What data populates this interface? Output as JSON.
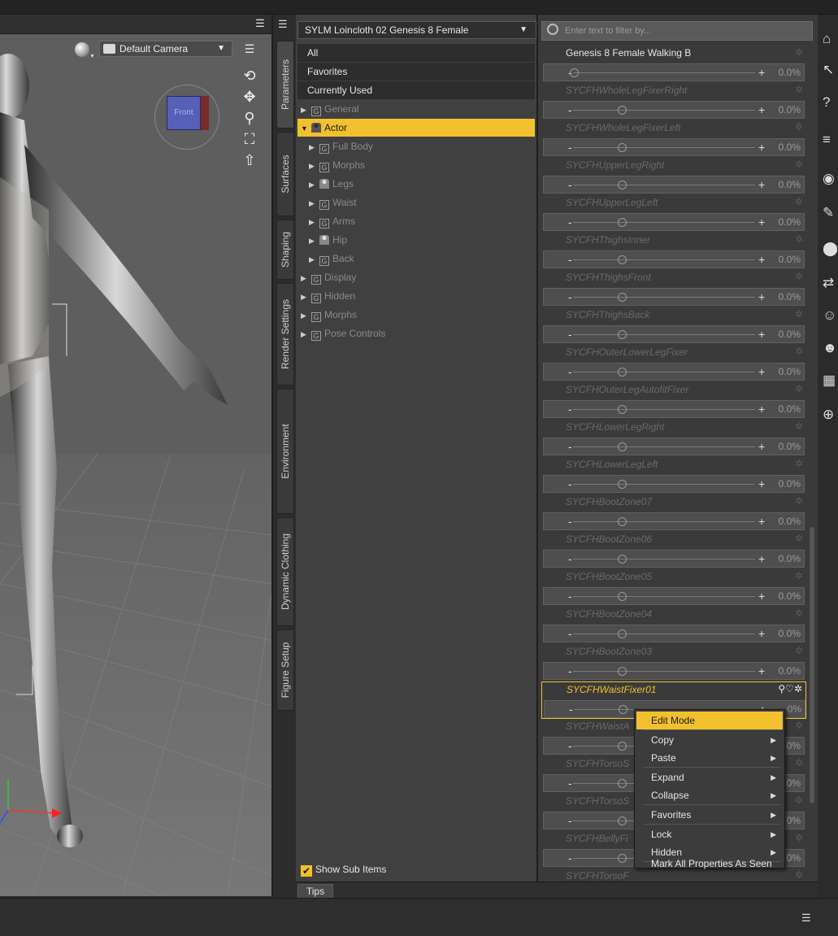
{
  "viewport": {
    "camera": "Default Camera",
    "view_cube_label": "Front"
  },
  "side_tabs": [
    "Parameters",
    "Surfaces",
    "Shaping",
    "Render Settings",
    "Environment",
    "Dynamic Clothing",
    "Figure Setup"
  ],
  "node_selector": "SYLM Loincloth 02 Genesis 8 Female",
  "categories": {
    "top": [
      "All",
      "Favorites",
      "Currently Used"
    ],
    "tree": [
      {
        "label": "General",
        "indent": 0,
        "icon": "group"
      },
      {
        "label": "Actor",
        "indent": 0,
        "icon": "figure",
        "selected": true
      },
      {
        "label": "Full Body",
        "indent": 1,
        "icon": "group"
      },
      {
        "label": "Morphs",
        "indent": 1,
        "icon": "group"
      },
      {
        "label": "Legs",
        "indent": 1,
        "icon": "figure"
      },
      {
        "label": "Waist",
        "indent": 1,
        "icon": "group"
      },
      {
        "label": "Arms",
        "indent": 1,
        "icon": "group"
      },
      {
        "label": "Hip",
        "indent": 1,
        "icon": "figure"
      },
      {
        "label": "Back",
        "indent": 1,
        "icon": "group"
      },
      {
        "label": "Display",
        "indent": 0,
        "icon": "group"
      },
      {
        "label": "Hidden",
        "indent": 0,
        "icon": "group"
      },
      {
        "label": "Morphs",
        "indent": 0,
        "icon": "group"
      },
      {
        "label": "Pose Controls",
        "indent": 0,
        "icon": "group"
      }
    ],
    "show_sub_items": "Show Sub Items"
  },
  "filter": {
    "placeholder": "Enter text to filter by..."
  },
  "properties": [
    {
      "name": "Genesis 8 Female Walking B",
      "value": "0.0%",
      "active": true,
      "knob_fraction": 0.0
    },
    {
      "name": "SYCFHWholeLegFixerRight",
      "value": "0.0%",
      "knob_fraction": 0.5
    },
    {
      "name": "SYCFHWholeLegFixerLeft",
      "value": "0.0%",
      "knob_fraction": 0.5
    },
    {
      "name": "SYCFHUpperLegRight",
      "value": "0.0%",
      "knob_fraction": 0.5
    },
    {
      "name": "SYCFHUpperLegLeft",
      "value": "0.0%",
      "knob_fraction": 0.5
    },
    {
      "name": "SYCFHThighsInner",
      "value": "0.0%",
      "knob_fraction": 0.5
    },
    {
      "name": "SYCFHThighsFront",
      "value": "0.0%",
      "knob_fraction": 0.5
    },
    {
      "name": "SYCFHThighsBack",
      "value": "0.0%",
      "knob_fraction": 0.5
    },
    {
      "name": "SYCFHOuterLowerLegFixer",
      "value": "0.0%",
      "knob_fraction": 0.5
    },
    {
      "name": "SYCFHOuterLegAutofitFixer",
      "value": "0.0%",
      "knob_fraction": 0.5
    },
    {
      "name": "SYCFHLowerLegRight",
      "value": "0.0%",
      "knob_fraction": 0.5
    },
    {
      "name": "SYCFHLowerLegLeft",
      "value": "0.0%",
      "knob_fraction": 0.5
    },
    {
      "name": "SYCFHBootZone07",
      "value": "0.0%",
      "knob_fraction": 0.5
    },
    {
      "name": "SYCFHBootZone06",
      "value": "0.0%",
      "knob_fraction": 0.5
    },
    {
      "name": "SYCFHBootZone05",
      "value": "0.0%",
      "knob_fraction": 0.5
    },
    {
      "name": "SYCFHBootZone04",
      "value": "0.0%",
      "knob_fraction": 0.5
    },
    {
      "name": "SYCFHBootZone03",
      "value": "0.0%",
      "knob_fraction": 0.5
    },
    {
      "name": "SYCFHWaistFixer01",
      "value": "0%",
      "highlight": true,
      "knob_fraction": 0.5
    },
    {
      "name": "SYCFHWaistA",
      "value": "0%",
      "knob_fraction": 0.5
    },
    {
      "name": "SYCFHTorsoS",
      "value": "0%",
      "knob_fraction": 0.5
    },
    {
      "name": "SYCFHTorsoS",
      "value": "0%",
      "knob_fraction": 0.5
    },
    {
      "name": "SYCFHBellyFi",
      "value": "0%",
      "knob_fraction": 0.5
    },
    {
      "name": "SYCFHTorsoF",
      "value": "",
      "knob_fraction": 0.5
    }
  ],
  "context_menu": [
    {
      "label": "Edit Mode",
      "selected": true,
      "submenu": false
    },
    {
      "label": "Copy",
      "submenu": true
    },
    {
      "label": "Paste",
      "submenu": true
    },
    {
      "label": "Expand",
      "submenu": true
    },
    {
      "label": "Collapse",
      "submenu": true
    },
    {
      "label": "Favorites",
      "submenu": true
    },
    {
      "label": "Lock",
      "submenu": true
    },
    {
      "label": "Hidden",
      "submenu": true
    },
    {
      "label": "Mark All Properties As Seen",
      "submenu": false
    }
  ],
  "tips_tab": "Tips",
  "right_toolbar_icons": [
    "ds-home-icon",
    "pointer-help-icon",
    "question-icon",
    "align-icon",
    "head-icon",
    "pose-icon",
    "morph-icon",
    "transfer-icon",
    "figure-icon",
    "figure-alt-icon",
    "grid-icon",
    "globe-icon"
  ],
  "colors": {
    "accent": "#f2c12e",
    "panel": "#3a3a3a",
    "viewport": "#5e5e5e"
  }
}
